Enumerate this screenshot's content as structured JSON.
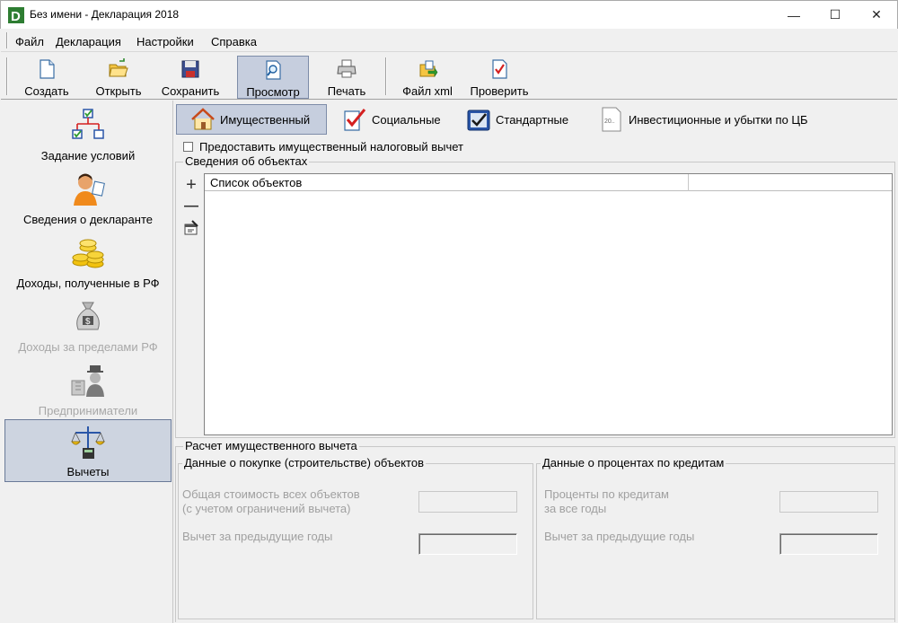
{
  "window": {
    "title": "Без имени - Декларация 2018",
    "minimize_glyph": "—",
    "maximize_glyph": "☐",
    "close_glyph": "✕"
  },
  "menu": {
    "items": [
      "Файл",
      "Декларация",
      "Настройки",
      "Справка"
    ]
  },
  "toolbar": {
    "buttons": [
      {
        "label": "Создать",
        "icon": "new-document-icon"
      },
      {
        "label": "Открыть",
        "icon": "open-folder-icon"
      },
      {
        "label": "Сохранить",
        "icon": "floppy-disk-icon"
      },
      {
        "label": "Просмотр",
        "icon": "preview-magnifier-icon",
        "active": true
      },
      {
        "label": "Печать",
        "icon": "printer-icon"
      },
      {
        "label": "Файл xml",
        "icon": "xml-file-icon"
      },
      {
        "label": "Проверить",
        "icon": "check-document-icon"
      }
    ]
  },
  "sidebar": {
    "items": [
      {
        "label": "Задание условий",
        "icon": "conditions-tree-icon",
        "disabled": false
      },
      {
        "label": "Сведения о декларанте",
        "icon": "person-icon",
        "disabled": false
      },
      {
        "label": "Доходы, полученные в РФ",
        "icon": "coins-icon",
        "disabled": false
      },
      {
        "label": "Доходы за пределами РФ",
        "icon": "money-bag-icon",
        "disabled": true
      },
      {
        "label": "Предприниматели",
        "icon": "businessman-icon",
        "disabled": true
      },
      {
        "label": "Вычеты",
        "icon": "scales-calculator-icon",
        "disabled": false,
        "active": true
      }
    ]
  },
  "tabs": [
    {
      "label": "Имущественный",
      "icon": "house-icon",
      "active": true
    },
    {
      "label": "Социальные",
      "icon": "checkmark-icon"
    },
    {
      "label": "Стандартные",
      "icon": "standard-check-icon"
    },
    {
      "label": "Инвестиционные и убытки по ЦБ",
      "icon": "securities-document-icon"
    }
  ],
  "property": {
    "checkbox_label": "Предоставить имущественный налоговый вычет",
    "checkbox_checked": false,
    "objects_group_title": "Сведения об объектах",
    "list_tools": {
      "add": "+",
      "remove": "—",
      "edit": "edit-icon"
    },
    "list_column_header": "Список объектов",
    "calc_group_title": "Расчет имущественного вычета",
    "purchase_group": {
      "title": "Данные о покупке (строительстве) объектов",
      "total_cost_label_1": "Общая стоимость всех объектов",
      "total_cost_label_2": "(с учетом ограничений вычета)",
      "prev_years_label": "Вычет за предыдущие годы"
    },
    "interest_group": {
      "title": "Данные о процентах по кредитам",
      "interest_label_1": "Проценты по кредитам",
      "interest_label_2": "за все годы",
      "prev_years_label": "Вычет за предыдущие годы"
    }
  }
}
